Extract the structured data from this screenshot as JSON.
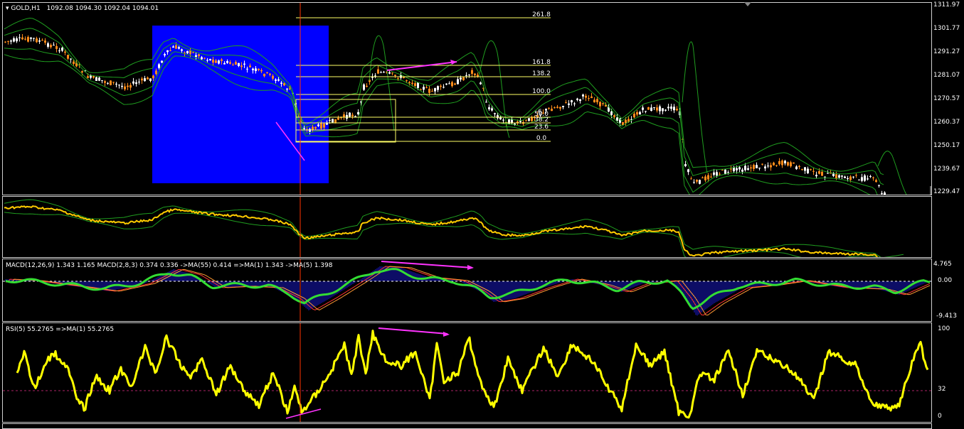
{
  "symbol": "GOLD,H1",
  "ohlc": "1092.08 1094.30 1092.04 1094.01",
  "price_axis": [
    "1311.97",
    "1301.77",
    "1291.27",
    "1281.07",
    "1270.57",
    "1260.37",
    "1250.17",
    "1239.67",
    "1229.47"
  ],
  "fibo_levels": [
    "261.8",
    "161.8",
    "138.2",
    "100.0",
    "50.0",
    "38.2",
    "23.6",
    "0.0"
  ],
  "fibo_partial": "6",
  "macd_header": "MACD(12,26,9) 1.343 1.165  MACD(2,8,3) 0.374 0.336  ->MA(55) 0.414  =>MA(1) 1.343  ->MA(5) 1.398",
  "macd_axis": [
    "4.765",
    "0.00",
    "-9.413"
  ],
  "rsi_header": "RSI(5) 55.2765  =>MA(1) 55.2765",
  "rsi_axis": [
    "100",
    "32",
    "0"
  ],
  "colors": {
    "bull": "#ffffff",
    "bear": "#ff8c1a",
    "band": "#1f9d1f",
    "highlight": "#0000ff",
    "fibo": "#ffff66",
    "arrow": "#ff33ff",
    "rsi": "#ffff00",
    "macd_hist": "#1a1acc",
    "macd_line": "#33dd33",
    "cursor": "#ff3300"
  }
}
